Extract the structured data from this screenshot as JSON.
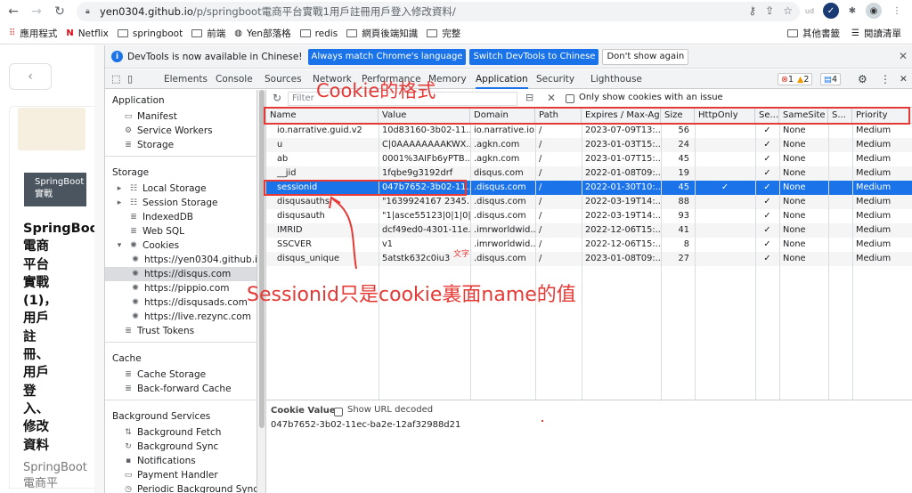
{
  "browser": {
    "url_host": "yen0304.github.io",
    "url_path": "/p/springboot電商平台實戰1用戶註冊用戶登入修改資料/",
    "bookmarks": [
      {
        "label": "應用程式",
        "icon": "apps-grid-icon"
      },
      {
        "label": "Netflix",
        "icon": "netflix-icon"
      },
      {
        "label": "springboot",
        "icon": "folder-icon"
      },
      {
        "label": "前端",
        "icon": "folder-icon"
      },
      {
        "label": "Yen部落格",
        "icon": "globe-icon"
      },
      {
        "label": "redis",
        "icon": "folder-icon"
      },
      {
        "label": "網頁後端知識",
        "icon": "folder-icon"
      },
      {
        "label": "完整",
        "icon": "folder-icon"
      }
    ],
    "other_bookmarks": "其他書籤",
    "reading_list": "閱讀清單"
  },
  "page": {
    "tag": "SpringBoot\n實戰",
    "title": "SpringBoot\n電商\n平台\n實戰\n(1)，\n用戶\n註\n冊、\n用戶\n登\n入、\n修改\n資料",
    "subtitle": "SpringBoot\n電商平"
  },
  "devtools": {
    "notice": {
      "message": "DevTools is now available in Chinese!",
      "btn_match": "Always match Chrome's language",
      "btn_switch": "Switch DevTools to Chinese",
      "btn_dismiss": "Don't show again"
    },
    "tabs": [
      "Elements",
      "Console",
      "Sources",
      "Network",
      "Performance",
      "Memory",
      "Application",
      "Security",
      "Lighthouse"
    ],
    "active_tab": "Application",
    "errors": "1",
    "warnings": "2",
    "messages": "4",
    "sidebar": {
      "application_header": "Application",
      "application_items": [
        "Manifest",
        "Service Workers",
        "Storage"
      ],
      "storage_header": "Storage",
      "storage_items": [
        "Local Storage",
        "Session Storage",
        "IndexedDB",
        "Web SQL",
        "Cookies"
      ],
      "cookie_origins": [
        "https://yen0304.github.io",
        "https://disqus.com",
        "https://pippio.com",
        "https://disqusads.com",
        "https://live.rezync.com"
      ],
      "selected_origin": "https://disqus.com",
      "trust_tokens": "Trust Tokens",
      "cache_header": "Cache",
      "cache_items": [
        "Cache Storage",
        "Back-forward Cache"
      ],
      "bg_header": "Background Services",
      "bg_items": [
        "Background Fetch",
        "Background Sync",
        "Notifications",
        "Payment Handler",
        "Periodic Background Sync"
      ]
    },
    "toolbar": {
      "filter_placeholder": "Filter",
      "only_issues_label": "Only show cookies with an issue"
    },
    "columns": [
      "Name",
      "Value",
      "Domain",
      "Path",
      "Expires / Max-Age",
      "Size",
      "HttpOnly",
      "Se...",
      "SameSite",
      "S...",
      "Priority"
    ],
    "cookies": [
      {
        "name": "io.narrative.guid.v2",
        "value": "10d83160-3b02-11...",
        "domain": "io.narrative.io",
        "path": "/",
        "expires": "2023-07-09T13:...",
        "size": "56",
        "httponly": "",
        "secure": "✓",
        "samesite": "None",
        "sp": "",
        "priority": "Medium"
      },
      {
        "name": "u",
        "value": "C|0AAAAAAAAKWX...",
        "domain": ".agkn.com",
        "path": "/",
        "expires": "2023-01-03T15:...",
        "size": "24",
        "httponly": "",
        "secure": "✓",
        "samesite": "None",
        "sp": "",
        "priority": "Medium"
      },
      {
        "name": "ab",
        "value": "0001%3AIFb6yPTB...",
        "domain": ".agkn.com",
        "path": "/",
        "expires": "2023-01-07T15:...",
        "size": "45",
        "httponly": "",
        "secure": "✓",
        "samesite": "None",
        "sp": "",
        "priority": "Medium"
      },
      {
        "name": "__jid",
        "value": "1fqbe9g3192drf",
        "domain": "disqus.com",
        "path": "/",
        "expires": "2022-01-08T09:...",
        "size": "19",
        "httponly": "",
        "secure": "✓",
        "samesite": "None",
        "sp": "",
        "priority": "Medium"
      },
      {
        "name": "sessionid",
        "value": "047b7652-3b02-11...",
        "domain": ".disqus.com",
        "path": "/",
        "expires": "2022-01-30T10:...",
        "size": "45",
        "httponly": "✓",
        "secure": "✓",
        "samesite": "None",
        "sp": "",
        "priority": "Medium"
      },
      {
        "name": "disqusauths",
        "value": "\"1639924167 2345...",
        "domain": ".disqus.com",
        "path": "/",
        "expires": "2022-03-19T14:...",
        "size": "88",
        "httponly": "",
        "secure": "✓",
        "samesite": "None",
        "sp": "",
        "priority": "Medium"
      },
      {
        "name": "disqusauth",
        "value": "\"1|asce55123|0|1|0||...",
        "domain": ".disqus.com",
        "path": "/",
        "expires": "2022-03-19T14:...",
        "size": "93",
        "httponly": "",
        "secure": "✓",
        "samesite": "None",
        "sp": "",
        "priority": "Medium"
      },
      {
        "name": "IMRID",
        "value": "dcf49ed0-4301-11e...",
        "domain": ".imrworldwid...",
        "path": "/",
        "expires": "2022-12-06T15:...",
        "size": "41",
        "httponly": "",
        "secure": "✓",
        "samesite": "None",
        "sp": "",
        "priority": "Medium"
      },
      {
        "name": "SSCVER",
        "value": "v1",
        "domain": ".imrworldwid...",
        "path": "/",
        "expires": "2022-12-06T15:...",
        "size": "8",
        "httponly": "",
        "secure": "✓",
        "samesite": "None",
        "sp": "",
        "priority": "Medium"
      },
      {
        "name": "disqus_unique",
        "value": "5atstk632c0iu3",
        "domain": ".disqus.com",
        "path": "/",
        "expires": "2023-01-08T09:...",
        "size": "27",
        "httponly": "",
        "secure": "✓",
        "samesite": "None",
        "sp": "",
        "priority": "Medium"
      }
    ],
    "selected_row": 4,
    "cookie_value_label": "Cookie Value",
    "show_url_decoded": "Show URL decoded",
    "cookie_value": "047b7652-3b02-11ec-ba2e-12af32988d21"
  },
  "annotations": {
    "top": "Cookie的格式",
    "bottom": "Sessionid只是cookie裏面name的值",
    "small": "文字",
    "color": "#e53935"
  }
}
